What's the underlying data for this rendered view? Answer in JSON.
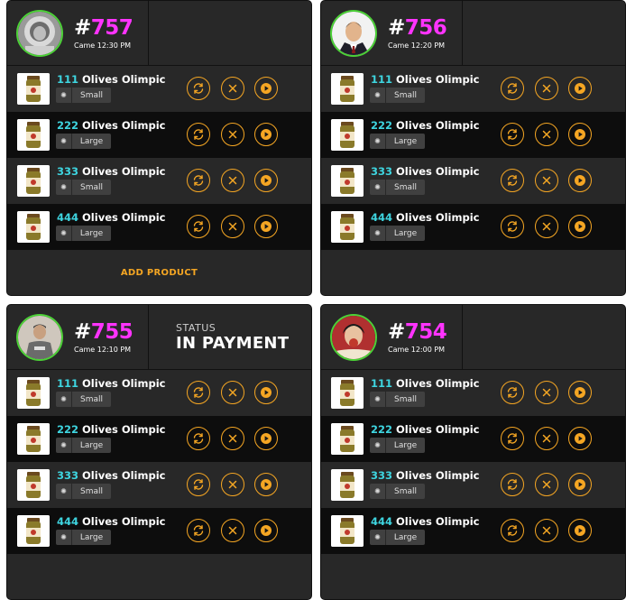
{
  "orders": [
    {
      "number": "757",
      "came": "Came 12:30 PM",
      "avatar": "astronaut-avatar",
      "status_label": "",
      "status_value": "",
      "footer_action": "ADD PRODUCT",
      "items": [
        {
          "code": "111",
          "name": "Olives Olimpic",
          "size": "Small"
        },
        {
          "code": "222",
          "name": "Olives Olimpic",
          "size": "Large"
        },
        {
          "code": "333",
          "name": "Olives Olimpic",
          "size": "Small"
        },
        {
          "code": "444",
          "name": "Olives Olimpic",
          "size": "Large"
        }
      ]
    },
    {
      "number": "756",
      "came": "Came 12:20 PM",
      "avatar": "man-suit-avatar",
      "status_label": "",
      "status_value": "",
      "footer_action": "",
      "items": [
        {
          "code": "111",
          "name": "Olives Olimpic",
          "size": "Small"
        },
        {
          "code": "222",
          "name": "Olives Olimpic",
          "size": "Large"
        },
        {
          "code": "333",
          "name": "Olives Olimpic",
          "size": "Small"
        },
        {
          "code": "444",
          "name": "Olives Olimpic",
          "size": "Large"
        }
      ]
    },
    {
      "number": "755",
      "came": "Came 12:10 PM",
      "avatar": "man-sweater-avatar",
      "status_label": "STATUS",
      "status_value": "IN PAYMENT",
      "footer_action": "",
      "items": [
        {
          "code": "111",
          "name": "Olives Olimpic",
          "size": "Small"
        },
        {
          "code": "222",
          "name": "Olives Olimpic",
          "size": "Large"
        },
        {
          "code": "333",
          "name": "Olives Olimpic",
          "size": "Small"
        },
        {
          "code": "444",
          "name": "Olives Olimpic",
          "size": "Large"
        }
      ]
    },
    {
      "number": "754",
      "came": "Came 12:00 PM",
      "avatar": "woman-eating-avatar",
      "status_label": "",
      "status_value": "",
      "footer_action": "",
      "items": [
        {
          "code": "111",
          "name": "Olives Olimpic",
          "size": "Small"
        },
        {
          "code": "222",
          "name": "Olives Olimpic",
          "size": "Large"
        },
        {
          "code": "333",
          "name": "Olives Olimpic",
          "size": "Small"
        },
        {
          "code": "444",
          "name": "Olives Olimpic",
          "size": "Large"
        }
      ]
    }
  ],
  "icons": {
    "replace": "refresh-icon",
    "remove": "close-icon",
    "play": "play-icon",
    "size": "sun-icon"
  },
  "colors": {
    "accent": "#f5a623",
    "order_number": "#ff33ff",
    "product_code": "#3ed5e0",
    "avatar_ring": "#4cd137",
    "card_bg": "#282828",
    "row_dark_bg": "#0d0d0d"
  }
}
